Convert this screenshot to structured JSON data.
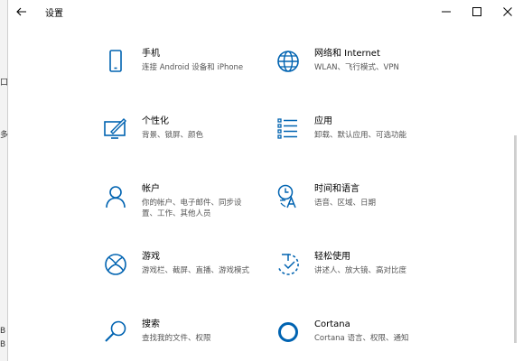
{
  "window": {
    "title": "设置"
  },
  "left_strip_chars": [
    "口",
    "多",
    "B",
    "B"
  ],
  "tiles": [
    {
      "label": "手机",
      "desc": "连接 Android 设备和 iPhone",
      "icon": "phone-icon"
    },
    {
      "label": "网络和 Internet",
      "desc": "WLAN、飞行模式、VPN",
      "icon": "globe-icon"
    },
    {
      "label": "个性化",
      "desc": "背景、锁屏、颜色",
      "icon": "personalization-icon"
    },
    {
      "label": "应用",
      "desc": "卸载、默认应用、可选功能",
      "icon": "apps-list-icon"
    },
    {
      "label": "帐户",
      "desc": "你的帐户、电子邮件、同步设置、工作、其他人员",
      "icon": "person-icon"
    },
    {
      "label": "时间和语言",
      "desc": "语音、区域、日期",
      "icon": "time-language-icon"
    },
    {
      "label": "游戏",
      "desc": "游戏栏、截屏、直播、游戏模式",
      "icon": "xbox-icon"
    },
    {
      "label": "轻松使用",
      "desc": "讲述人、放大镜、高对比度",
      "icon": "ease-of-access-icon"
    },
    {
      "label": "搜索",
      "desc": "查找我的文件、权限",
      "icon": "search-icon"
    },
    {
      "label": "Cortana",
      "desc": "Cortana 语言、权限、通知",
      "icon": "cortana-icon"
    }
  ],
  "colors": {
    "accent": "#0063b1",
    "text": "#000000",
    "secondary_text": "#555555"
  }
}
